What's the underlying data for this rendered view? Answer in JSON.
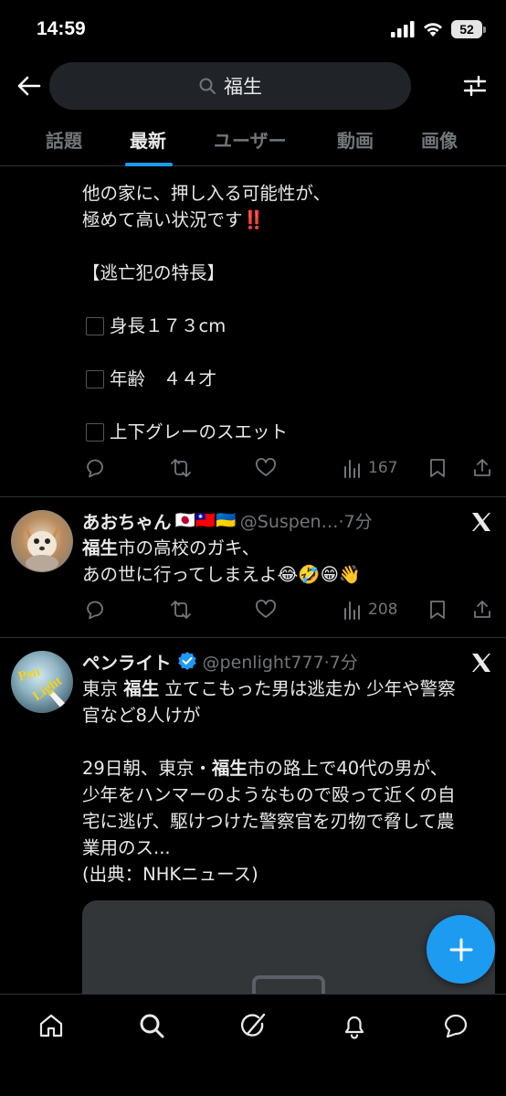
{
  "status": {
    "time": "14:59",
    "battery": "52"
  },
  "search": {
    "query": "福生"
  },
  "tabs": [
    "話題",
    "最新",
    "ユーザー",
    "動画",
    "画像"
  ],
  "post1": {
    "lines": [
      "他の家に、押し入る可能性が、",
      "極めて高い状況です",
      "【逃亡犯の特長】",
      "身長１７３cm",
      "年齢　４４才",
      "上下グレーのスエット"
    ],
    "emoji": "‼️",
    "views": "167"
  },
  "post2": {
    "name": "あおちゃん",
    "flags": "🇯🇵🇹🇼🇺🇦",
    "handle": "@Suspen…·7分",
    "keyword": "福生",
    "line1_rest": "市の高校のガキ、",
    "line2": "あの世に行ってしまえよ😂🤣😁👋",
    "views": "208"
  },
  "post3": {
    "name": "ペンライト",
    "handle": "@penlight777·7分",
    "avatar_text": "Pen Light",
    "l1a": "東京 ",
    "l1b": "福生",
    "l1c": " 立てこもった男は逃走か 少年や警察",
    "l2": "官など8人けが",
    "l3a": "29日朝、東京・",
    "l3b": "福生",
    "l3c": "市の路上で40代の男が、",
    "l4": "少年をハンマーのようなもので殴って近くの自",
    "l5": "宅に逃げ、駆けつけた警察官を刃物で脅して農",
    "l6": "業用のス...",
    "l7": "(出典：NHKニュース)"
  },
  "colors": {
    "accent": "#1d9bf0",
    "background": "#000000",
    "secondary_text": "#71767b"
  }
}
